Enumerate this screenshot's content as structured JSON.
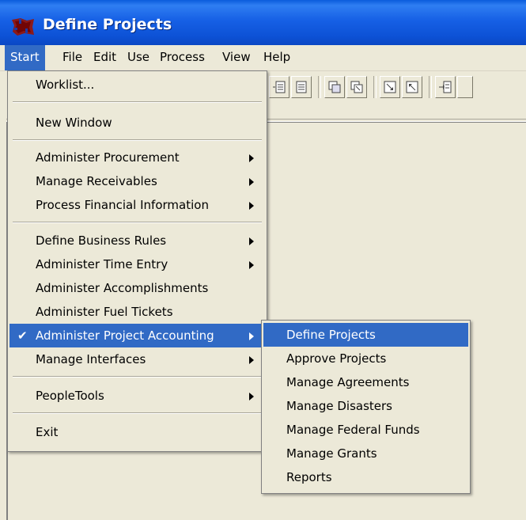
{
  "window": {
    "title": "Define Projects",
    "icon": "app-logo-icon"
  },
  "menubar": {
    "items": [
      {
        "label": "Start",
        "active": true
      },
      {
        "label": "File"
      },
      {
        "label": "Edit"
      },
      {
        "label": "Use"
      },
      {
        "label": "Process"
      },
      {
        "label": "View"
      },
      {
        "label": "Help"
      }
    ]
  },
  "toolbar": {
    "buttons": [
      "record-list-icon",
      "record-icon",
      "copy-icon",
      "copy-all-icon",
      "next-icon",
      "previous-icon",
      "insert-row-icon"
    ]
  },
  "start_menu": {
    "items": [
      {
        "label": "Worklist..."
      },
      {
        "label": "New Window"
      },
      {
        "label": "Administer Procurement",
        "submenu": true
      },
      {
        "label": "Manage Receivables",
        "submenu": true
      },
      {
        "label": "Process Financial Information",
        "submenu": true
      },
      {
        "label": "Define Business Rules",
        "submenu": true
      },
      {
        "label": "Administer Time Entry",
        "submenu": true
      },
      {
        "label": "Administer Accomplishments"
      },
      {
        "label": "Administer Fuel Tickets"
      },
      {
        "label": "Administer Project Accounting",
        "submenu": true,
        "checked": true,
        "highlighted": true
      },
      {
        "label": "Manage Interfaces",
        "submenu": true
      },
      {
        "label": "PeopleTools",
        "submenu": true
      },
      {
        "label": "Exit"
      }
    ],
    "check_mark": "✔"
  },
  "project_accounting_submenu": {
    "items": [
      {
        "label": "Define Projects",
        "highlighted": true
      },
      {
        "label": "Approve Projects"
      },
      {
        "label": "Manage Agreements"
      },
      {
        "label": "Manage Disasters"
      },
      {
        "label": "Manage Federal Funds"
      },
      {
        "label": "Manage Grants"
      },
      {
        "label": "Reports"
      }
    ]
  },
  "colors": {
    "titlebar": "#0A5BDC",
    "highlight": "#316AC5",
    "face": "#ECE9D8"
  }
}
